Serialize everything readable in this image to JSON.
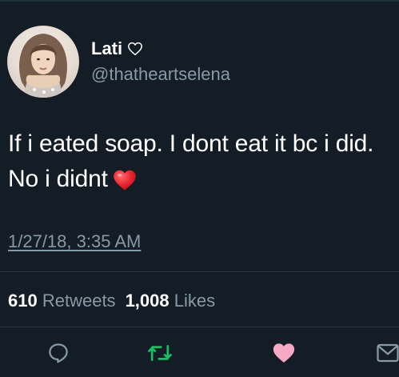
{
  "user": {
    "display_name": "Lati",
    "handle": "@thatheartselena",
    "name_icon": "heart-outline-icon"
  },
  "tweet": {
    "text": "If i eated soap. I dont eat it bc i did. No i didnt",
    "emoji": "red-heart-emoji",
    "timestamp": "1/27/18, 3:35 AM"
  },
  "stats": {
    "retweets_count": "610",
    "retweets_label": "Retweets",
    "likes_count": "1,008",
    "likes_label": "Likes"
  },
  "actions": [
    "reply-icon",
    "retweet-icon",
    "like-icon",
    "direct-message-icon"
  ],
  "colors": {
    "background": "#141d26",
    "secondary_text": "#8899a6",
    "retweet_green": "#17bf63",
    "like_pink": "#f6a9c4",
    "heart_red": "#e0245e"
  }
}
